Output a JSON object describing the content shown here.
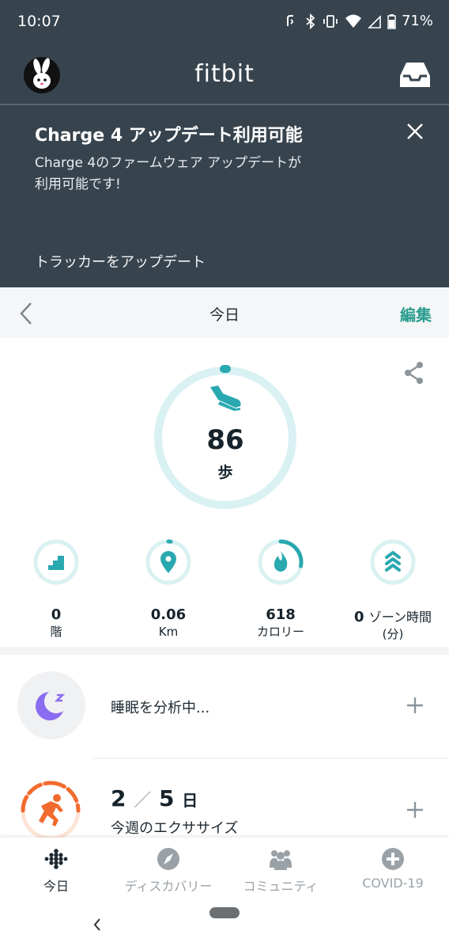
{
  "status_bar": {
    "time": "10:07",
    "battery": "71%"
  },
  "header": {
    "app_name": "fitbit"
  },
  "banner": {
    "title": "Charge 4 アップデート利用可能",
    "message_line1": "Charge 4のファームウェア アップデートが",
    "message_line2": "利用可能です!",
    "action": "トラッカーをアップデート"
  },
  "date_bar": {
    "title": "今日",
    "edit": "編集"
  },
  "steps": {
    "value": "86",
    "unit": "歩"
  },
  "stats": [
    {
      "value": "0",
      "unit": "階"
    },
    {
      "value": "0.06",
      "unit": "Km"
    },
    {
      "value": "618",
      "unit": "カロリー"
    },
    {
      "value": "0",
      "value_suffix": "ゾーン時間",
      "unit": "(分)"
    }
  ],
  "sleep": {
    "label": "睡眠を分析中..."
  },
  "exercise": {
    "done": "2",
    "separator": "／",
    "goal": "5",
    "unit": "日",
    "label": "今週のエクササイズ"
  },
  "bottom_nav": [
    {
      "label": "今日",
      "icon": "fitbit-dots-icon"
    },
    {
      "label": "ディスカバリー",
      "icon": "compass-icon"
    },
    {
      "label": "コミュニティ",
      "icon": "community-icon"
    },
    {
      "label": "COVID-19",
      "icon": "plus-circle-icon"
    }
  ],
  "colors": {
    "header_bg": "#37444e",
    "accent_teal": "#2aa8b0",
    "edit_green": "#2a9d8f",
    "sleep_purple": "#8a6cf0",
    "exercise_orange": "#f26b2e"
  }
}
